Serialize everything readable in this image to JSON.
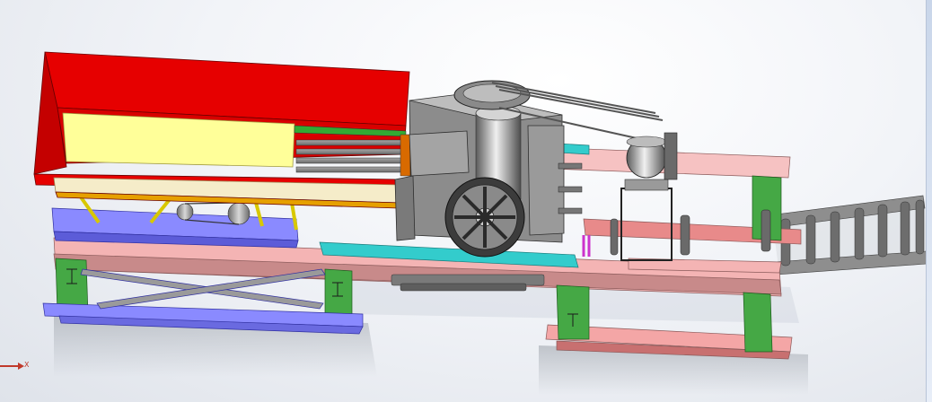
{
  "view": {
    "triad_axis_label": "X",
    "colors": {
      "hopper_red": "#e60000",
      "hopper_inner": "#ffff99",
      "frame_pink": "#f4b4b4",
      "frame_blue": "#8a8aff",
      "frame_green": "#44a844",
      "accent_cyan": "#33cccc",
      "machine_grey": "#8c8c8c",
      "conveyor_grey": "#9a9a9a",
      "background": "#eef1f6"
    },
    "icons": [
      "coordinate-triad-icon"
    ]
  }
}
